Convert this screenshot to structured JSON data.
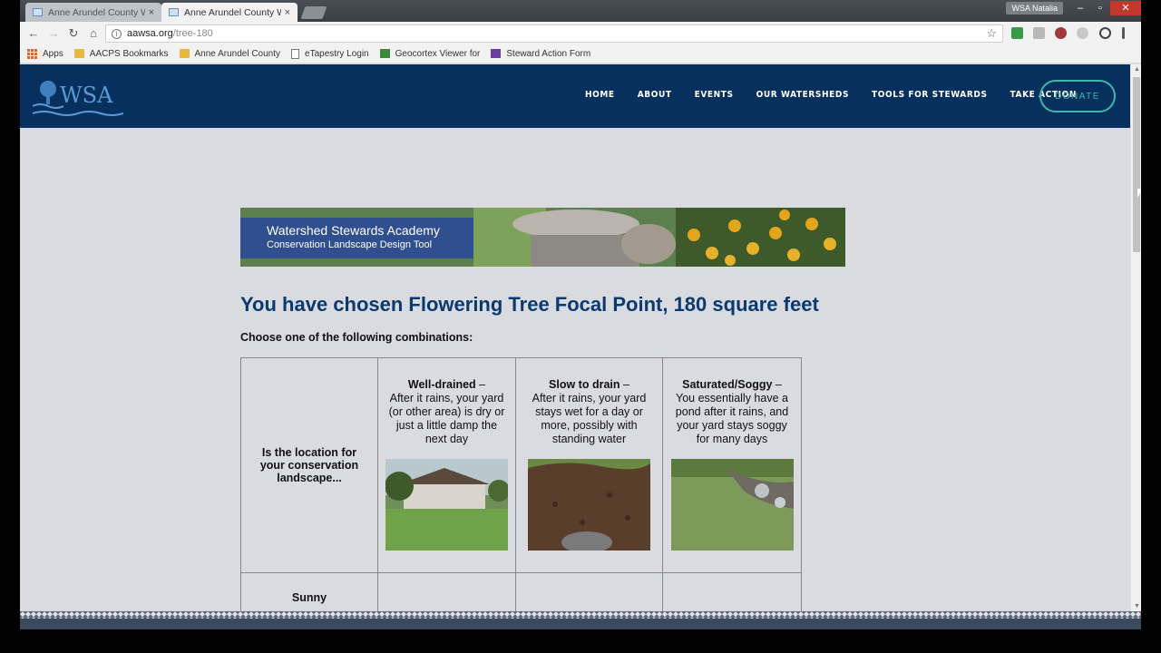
{
  "browser": {
    "tabs": [
      {
        "title": "Anne Arundel County W",
        "close": "×",
        "active": false
      },
      {
        "title": "Anne Arundel County W",
        "close": "×",
        "active": true
      }
    ],
    "profile": "WSA Natalia",
    "window_controls": {
      "minimize": "–",
      "restore": "▫",
      "close": "✕"
    },
    "address": {
      "domain": "aawsa.org",
      "path": "/tree-180"
    },
    "nav": {
      "back": "←",
      "forward": "→",
      "reload": "↻",
      "home": "⌂"
    },
    "star": "☆",
    "bookmarks": [
      {
        "label": "Apps",
        "icon": "apps-icon"
      },
      {
        "label": "AACPS Bookmarks",
        "icon": "folder-icon"
      },
      {
        "label": "Anne Arundel County",
        "icon": "folder-icon"
      },
      {
        "label": "eTapestry Login",
        "icon": "page-icon"
      },
      {
        "label": "Geocortex Viewer for",
        "icon": "geocortex-icon"
      },
      {
        "label": "Steward Action Form",
        "icon": "form-icon"
      }
    ]
  },
  "site": {
    "logo": "WSA",
    "nav": [
      "HOME",
      "ABOUT",
      "EVENTS",
      "OUR WATERSHEDS",
      "TOOLS FOR STEWARDS",
      "TAKE ACTION"
    ],
    "donate": "DONATE",
    "colors": {
      "header": "#08305f",
      "accent": "#3fb6a8",
      "heading": "#0b3a6f"
    }
  },
  "page": {
    "banner": {
      "line1": "Watershed Stewards Academy",
      "line2": "Conservation Landscape Design Tool"
    },
    "heading": "You have chosen Flowering Tree Focal Point, 180 square feet",
    "subheading": "Choose one of the following combinations:",
    "table": {
      "corner": "Is the location for your conservation landscape...",
      "columns": [
        {
          "label": "Well-drained",
          "desc": "After it rains, your yard (or other area) is dry or just a little damp the next day"
        },
        {
          "label": "Slow to drain",
          "desc": "After it rains, your yard stays wet for a day or more, possibly with standing water"
        },
        {
          "label": "Saturated/Soggy",
          "desc": "You essentially have a pond after it rains, and your yard stays soggy for many days"
        }
      ],
      "dash": " –",
      "rows": [
        "Sunny"
      ]
    }
  }
}
